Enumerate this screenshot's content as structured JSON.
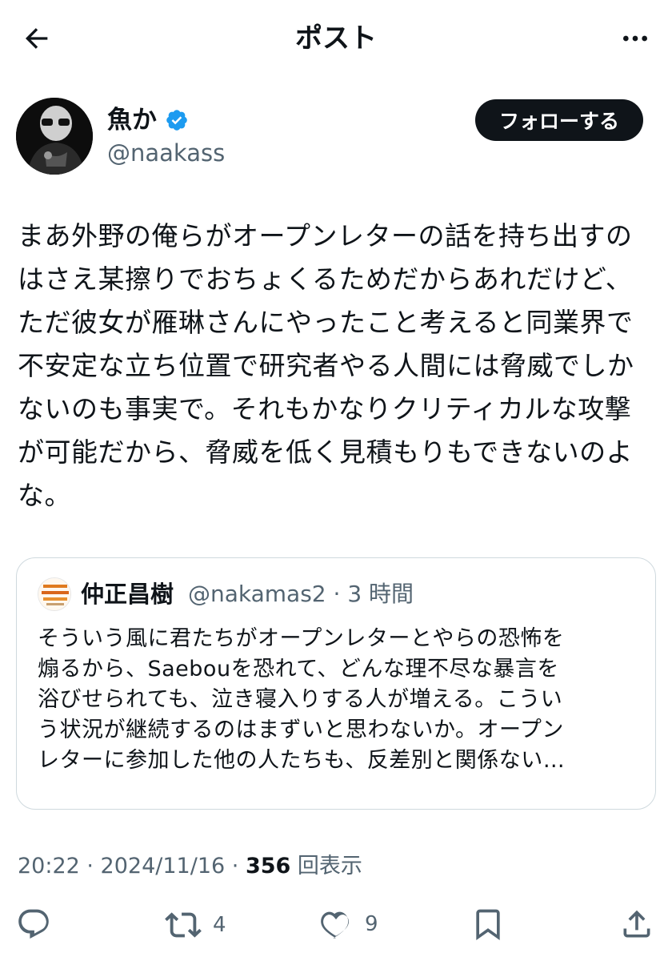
{
  "header": {
    "title": "ポスト"
  },
  "author": {
    "name": "魚か",
    "handle": "@naakass",
    "follow_label": "フォローする"
  },
  "post": {
    "text": "まあ外野の俺らがオープンレターの話を持ち出すの\nはさえ某擦りでおちょくるためだからあれだけど、\nただ彼女が雁琳さんにやったこと考えると同業界で\n不安定な立ち位置で研究者やる人間には脅威でしか\nないのも事実で。それもかなりクリティカルな攻撃\nが可能だから、脅威を低く見積もりもできないのよ\nな。"
  },
  "quoted": {
    "name": "仲正昌樹",
    "meta": "@nakamas2 · 3 時間",
    "text": "そういう風に君たちがオープンレターとやらの恐怖を\n煽るから、Saebouを恐れて、どんな理不尽な暴言を\n浴びせられても、泣き寝入りする人が増える。こうい\nう状況が継続するのはまずいと思わないか。オープン\nレターに参加した他の人たちも、反差別と関係ない…"
  },
  "meta": {
    "time": "20:22 · 2024/11/16 · ",
    "views_count": "356",
    "views_label": " 回表示"
  },
  "actions": {
    "repost_count": "4",
    "like_count": "9"
  },
  "colors": {
    "text": "#0f1419",
    "muted": "#536471",
    "verified": "#1d9bf0",
    "border": "#cfd9de"
  }
}
